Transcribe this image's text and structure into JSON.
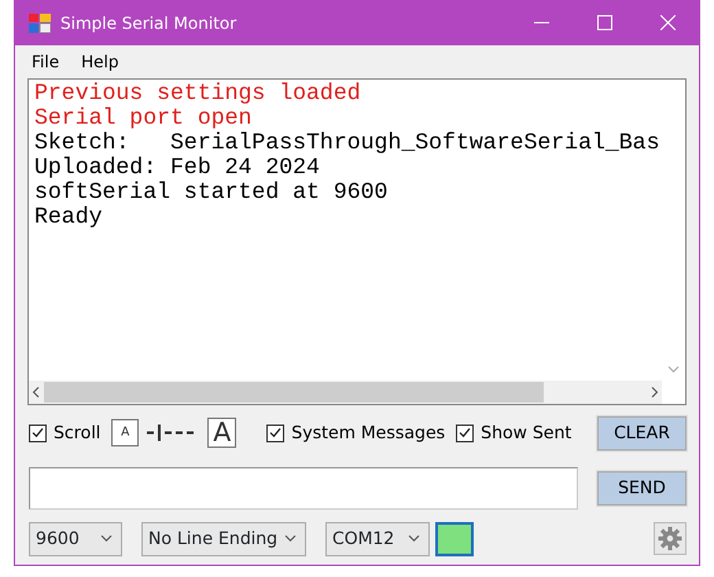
{
  "window": {
    "title": "Simple Serial Monitor"
  },
  "menu": [
    "File",
    "Help"
  ],
  "console": {
    "lines": [
      {
        "kind": "system",
        "text": "Previous settings loaded"
      },
      {
        "kind": "system",
        "text": "Serial port open"
      },
      {
        "kind": "data",
        "text": "Sketch:   SerialPassThrough_SoftwareSerial_Bas"
      },
      {
        "kind": "data",
        "text": "Uploaded: Feb 24 2024"
      },
      {
        "kind": "data",
        "text": "softSerial started at 9600"
      },
      {
        "kind": "data",
        "text": "Ready"
      }
    ]
  },
  "options": [
    {
      "kind": "checkbox",
      "label": "Scroll",
      "checked": true
    },
    {
      "kind": "font_size",
      "small": "A",
      "large": "A",
      "level": 0.25
    },
    {
      "kind": "checkbox",
      "label": "System Messages",
      "checked": true
    },
    {
      "kind": "checkbox",
      "label": "Show Sent",
      "checked": true
    }
  ],
  "buttons": {
    "clear": "CLEAR",
    "send": "SEND"
  },
  "baud": "9600",
  "line_ending": "No Line Ending",
  "port": "COM12",
  "status": {
    "color": "#7ee07e"
  }
}
